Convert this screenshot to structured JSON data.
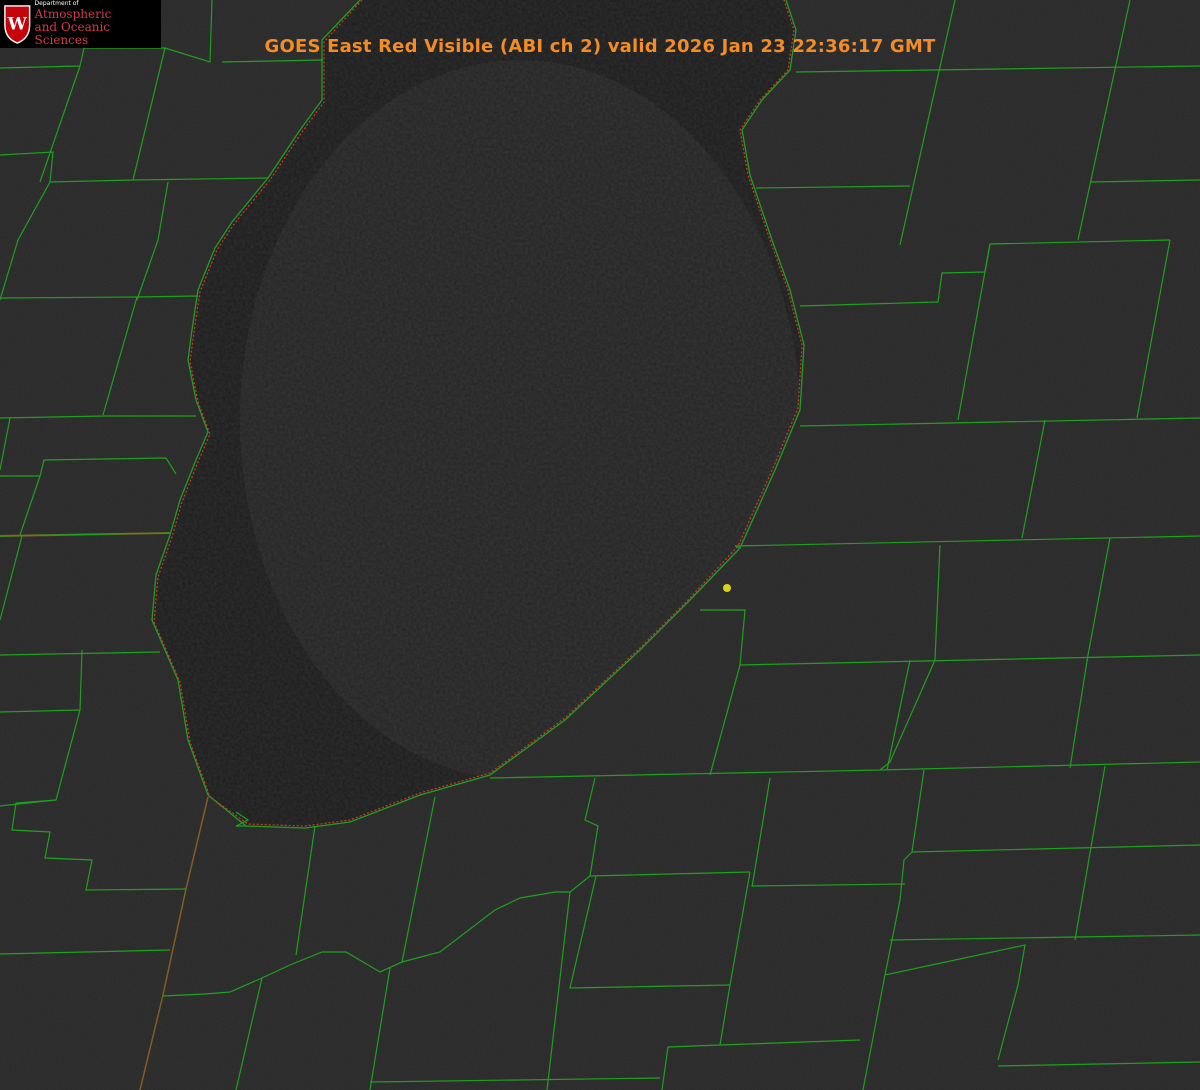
{
  "logo": {
    "crest_letter": "W",
    "department_line": "Department of",
    "org_line1": "Atmospheric",
    "org_line2": "and Oceanic Sciences"
  },
  "title": "GOES East Red Visible (ABI ch 2) valid 2026 Jan 23 22:36:17 GMT",
  "colors": {
    "background": "#262626",
    "lake": "#1b1b1b",
    "county_lines": "#1fa01f",
    "state_line": "#c0392b",
    "title": "#f28c28",
    "marker": "#d9d21a",
    "crest_red": "#c5050c"
  },
  "icons": {
    "crest": "university-crest-icon",
    "marker": "location-dot-icon"
  }
}
